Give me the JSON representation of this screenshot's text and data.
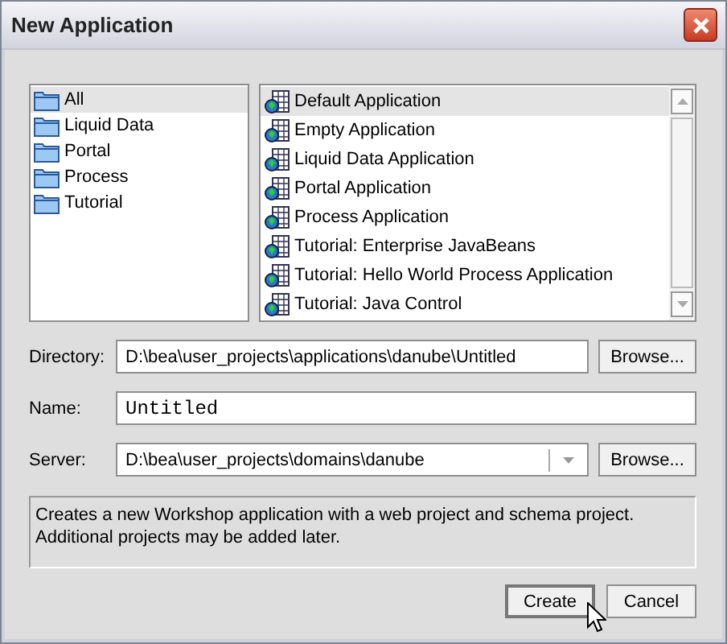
{
  "window": {
    "title": "New Application"
  },
  "categories": [
    {
      "label": "All",
      "selected": true
    },
    {
      "label": "Liquid Data",
      "selected": false
    },
    {
      "label": "Portal",
      "selected": false
    },
    {
      "label": "Process",
      "selected": false
    },
    {
      "label": "Tutorial",
      "selected": false
    }
  ],
  "templates": [
    {
      "label": "Default Application",
      "selected": true
    },
    {
      "label": "Empty Application",
      "selected": false
    },
    {
      "label": "Liquid Data Application",
      "selected": false
    },
    {
      "label": "Portal Application",
      "selected": false
    },
    {
      "label": "Process Application",
      "selected": false
    },
    {
      "label": "Tutorial: Enterprise JavaBeans",
      "selected": false
    },
    {
      "label": "Tutorial: Hello World Process Application",
      "selected": false
    },
    {
      "label": "Tutorial: Java Control",
      "selected": false
    }
  ],
  "fields": [
    {
      "kind": "path",
      "label": "Directory:",
      "value": "D:\\bea\\user_projects\\applications\\danube\\Untitled",
      "button": "Browse..."
    },
    {
      "kind": "text",
      "label": "Name:",
      "value": "Untitled"
    },
    {
      "kind": "combo",
      "label": "Server:",
      "value": "D:\\bea\\user_projects\\domains\\danube",
      "button": "Browse..."
    }
  ],
  "description": "Creates a new Workshop application with a web project and schema project. Additional projects may be added later.",
  "buttons": [
    {
      "label": "Create",
      "default": true
    },
    {
      "label": "Cancel",
      "default": false
    }
  ]
}
